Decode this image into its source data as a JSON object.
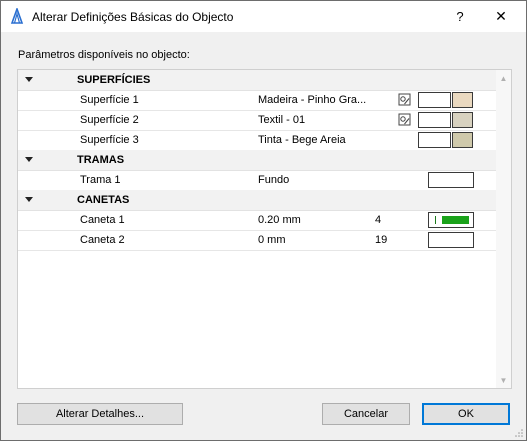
{
  "window": {
    "title": "Alterar Definições Básicas do Objecto",
    "help_label": "?",
    "close_label": "✕"
  },
  "params_label": "Parâmetros disponíveis no objecto:",
  "groups": {
    "superficies": {
      "title": "SUPERFÍCIES",
      "items": [
        {
          "name": "Superfície 1",
          "value": "Madeira - Pinho Gra...",
          "color": "#ead9c0"
        },
        {
          "name": "Superfície 2",
          "value": "Textil - 01",
          "color": "#d8d2c0"
        },
        {
          "name": "Superfície 3",
          "value": "Tinta - Bege Areia",
          "color": "#cfc9ab"
        }
      ]
    },
    "tramas": {
      "title": "TRAMAS",
      "items": [
        {
          "name": "Trama 1",
          "value": "Fundo"
        }
      ]
    },
    "canetas": {
      "title": "CANETAS",
      "items": [
        {
          "name": "Caneta 1",
          "value": "0.20 mm",
          "number": "4"
        },
        {
          "name": "Caneta 2",
          "value": "0 mm",
          "number": "19"
        }
      ]
    }
  },
  "buttons": {
    "details": "Alterar Detalhes...",
    "cancel": "Cancelar",
    "ok": "OK"
  },
  "colors": {
    "pen_green": "#1aa21a",
    "ok_border": "#0078d7"
  }
}
